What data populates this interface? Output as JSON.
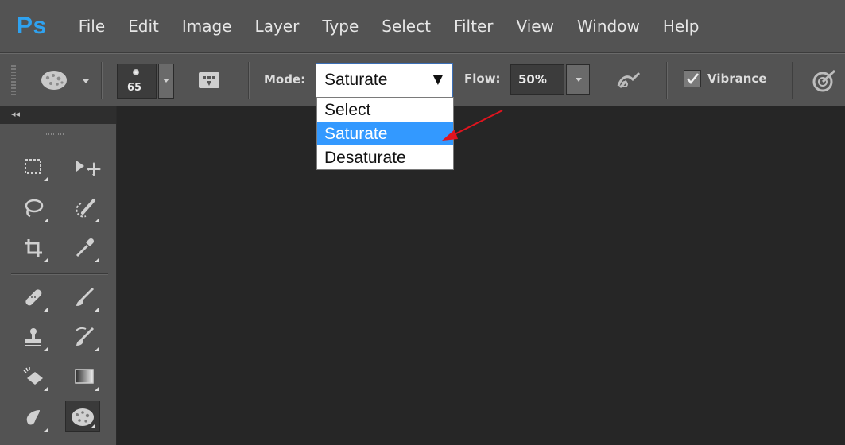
{
  "app": {
    "logo": "Ps"
  },
  "menu": [
    "File",
    "Edit",
    "Image",
    "Layer",
    "Type",
    "Select",
    "Filter",
    "View",
    "Window",
    "Help"
  ],
  "options": {
    "brush_size": "65",
    "mode_label": "Mode:",
    "mode_value": "Saturate",
    "flow_label": "Flow:",
    "flow_value": "50%",
    "vibrance_label": "Vibrance",
    "vibrance_checked": true
  },
  "mode_dropdown": {
    "options": [
      "Select",
      "Saturate",
      "Desaturate"
    ],
    "highlighted": "Saturate"
  },
  "toolbar": {
    "collapse_glyph": "◂◂",
    "tools": [
      "rectangular-marquee-tool",
      "move-tool",
      "lasso-tool",
      "quick-selection-tool",
      "crop-tool",
      "eyedropper-tool",
      "spot-healing-brush-tool",
      "brush-tool",
      "clone-stamp-tool",
      "history-brush-tool",
      "eraser-tool",
      "gradient-tool",
      "blur-tool",
      "sponge-tool"
    ],
    "active_tool": "sponge-tool"
  },
  "colors": {
    "accent": "#3399ff",
    "logo": "#2fa2f0",
    "annotation_arrow": "#e0141e"
  }
}
